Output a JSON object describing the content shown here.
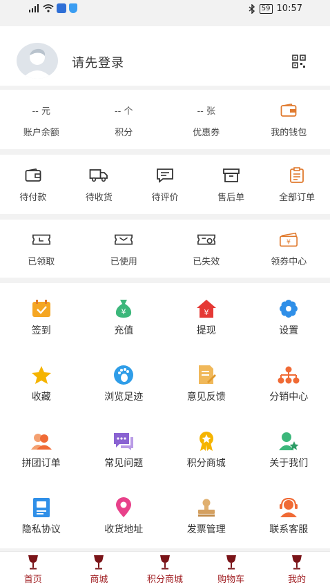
{
  "status_bar": {
    "time": "10:57",
    "battery": "59"
  },
  "profile": {
    "login_prompt": "请先登录"
  },
  "assets": [
    {
      "value": "-- 元",
      "label": "账户余额"
    },
    {
      "value": "-- 个",
      "label": "积分"
    },
    {
      "value": "-- 张",
      "label": "优惠券"
    },
    {
      "label": "我的钱包",
      "icon": "wallet-icon"
    }
  ],
  "orders": [
    {
      "label": "待付款",
      "icon": "wallet-icon"
    },
    {
      "label": "待收货",
      "icon": "truck-icon"
    },
    {
      "label": "待评价",
      "icon": "comment-icon"
    },
    {
      "label": "售后单",
      "icon": "box-icon"
    },
    {
      "label": "全部订单",
      "icon": "clipboard-icon"
    }
  ],
  "coupons": [
    {
      "label": "已领取",
      "icon": "ticket-icon"
    },
    {
      "label": "已使用",
      "icon": "ticket-used-icon"
    },
    {
      "label": "已失效",
      "icon": "ticket-expired-icon"
    },
    {
      "label": "领券中心",
      "icon": "coupon-center-icon"
    }
  ],
  "services": [
    {
      "label": "签到",
      "icon": "calendar-check-icon"
    },
    {
      "label": "充值",
      "icon": "money-bag-icon"
    },
    {
      "label": "提现",
      "icon": "house-yen-icon"
    },
    {
      "label": "设置",
      "icon": "gear-icon"
    },
    {
      "label": "收藏",
      "icon": "star-icon"
    },
    {
      "label": "浏览足迹",
      "icon": "footprint-icon"
    },
    {
      "label": "意见反馈",
      "icon": "feedback-icon"
    },
    {
      "label": "分销中心",
      "icon": "hierarchy-icon"
    },
    {
      "label": "拼团订单",
      "icon": "group-icon"
    },
    {
      "label": "常见问题",
      "icon": "chat-icon"
    },
    {
      "label": "积分商城",
      "icon": "medal-icon"
    },
    {
      "label": "关于我们",
      "icon": "user-star-icon"
    },
    {
      "label": "隐私协议",
      "icon": "document-icon"
    },
    {
      "label": "收货地址",
      "icon": "location-pin-icon"
    },
    {
      "label": "发票管理",
      "icon": "stamp-icon"
    },
    {
      "label": "联系客服",
      "icon": "headset-icon"
    }
  ],
  "tabbar": [
    {
      "label": "首页"
    },
    {
      "label": "商城"
    },
    {
      "label": "积分商城"
    },
    {
      "label": "购物车"
    },
    {
      "label": "我的"
    }
  ],
  "colors": {
    "accent": "#a01e22",
    "orange": "#f08a3c",
    "blue": "#2f8fe8",
    "green": "#3cb77b",
    "purple": "#8a63d2"
  }
}
